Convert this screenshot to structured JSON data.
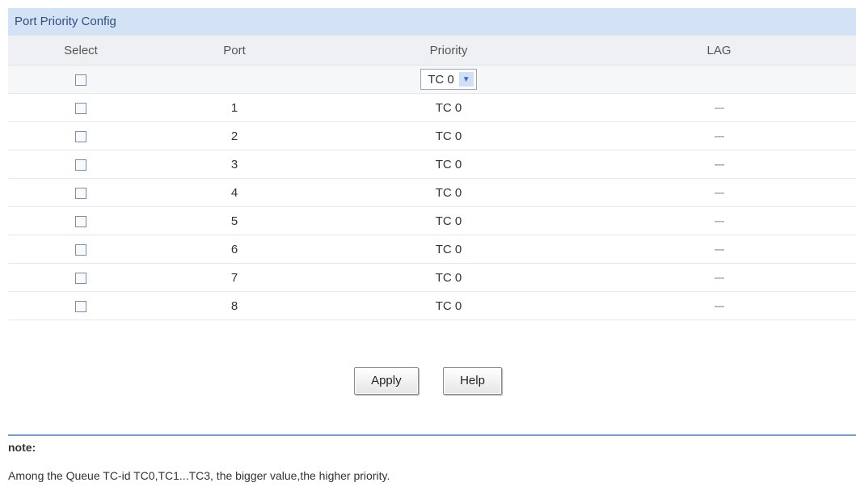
{
  "panel": {
    "title": "Port Priority Config"
  },
  "table": {
    "headers": {
      "select": "Select",
      "port": "Port",
      "priority": "Priority",
      "lag": "LAG"
    },
    "filter_priority": "TC 0",
    "rows": [
      {
        "port": "1",
        "priority": "TC 0",
        "lag": "---"
      },
      {
        "port": "2",
        "priority": "TC 0",
        "lag": "---"
      },
      {
        "port": "3",
        "priority": "TC 0",
        "lag": "---"
      },
      {
        "port": "4",
        "priority": "TC 0",
        "lag": "---"
      },
      {
        "port": "5",
        "priority": "TC 0",
        "lag": "---"
      },
      {
        "port": "6",
        "priority": "TC 0",
        "lag": "---"
      },
      {
        "port": "7",
        "priority": "TC 0",
        "lag": "---"
      },
      {
        "port": "8",
        "priority": "TC 0",
        "lag": "---"
      }
    ]
  },
  "buttons": {
    "apply": "Apply",
    "help": "Help"
  },
  "note": {
    "label": "note:",
    "text": "Among the Queue TC-id TC0,TC1...TC3, the bigger value,the higher priority."
  }
}
